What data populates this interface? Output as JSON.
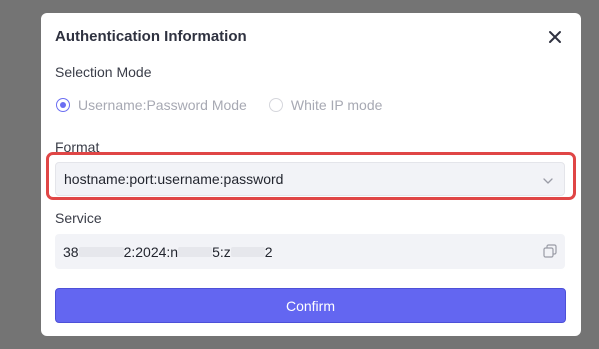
{
  "modal": {
    "title": "Authentication Information",
    "selection_mode_label": "Selection Mode",
    "modes": [
      {
        "label": "Username:Password Mode",
        "checked": true
      },
      {
        "label": "White IP mode",
        "checked": false
      }
    ],
    "format_label": "Format",
    "format_value": "hostname:port:username:password",
    "service_label": "Service",
    "service_parts": [
      "38",
      "2:2024:n",
      "5:z",
      "2"
    ],
    "confirm_label": "Confirm"
  },
  "colors": {
    "accent": "#6366f1",
    "highlight": "#e04646",
    "overlay": "#747474"
  },
  "icons": {
    "close": "close-icon",
    "chevron": "chevron-down-icon",
    "copy": "copy-icon"
  }
}
